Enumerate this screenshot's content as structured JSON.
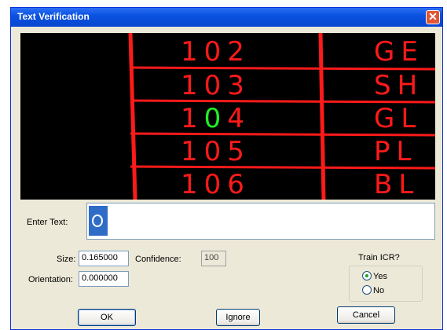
{
  "window": {
    "title": "Text Verification",
    "close_glyph": "✕"
  },
  "preview": {
    "rows": [
      {
        "number": "102",
        "text": "GE"
      },
      {
        "number": "103",
        "text": "SH"
      },
      {
        "number": "104",
        "text": "GL",
        "highlight_digit": "0"
      },
      {
        "number": "105",
        "text": "PL"
      },
      {
        "number": "106",
        "text": "BL"
      }
    ],
    "colors": {
      "background": "#000000",
      "lines": "#ff1a1a",
      "highlight": "#22ee22"
    }
  },
  "enter_text": {
    "label": "Enter Text:",
    "value": ""
  },
  "size": {
    "label": "Size:",
    "value": "0.165000"
  },
  "orientation": {
    "label": "Orientation:",
    "value": "0.000000"
  },
  "confidence": {
    "label": "Confidence:",
    "value": "100"
  },
  "train_icr": {
    "label": "Train ICR?",
    "options": [
      "Yes",
      "No"
    ],
    "selected": "Yes"
  },
  "buttons": {
    "ok": "OK",
    "ignore": "Ignore",
    "cancel": "Cancel"
  }
}
